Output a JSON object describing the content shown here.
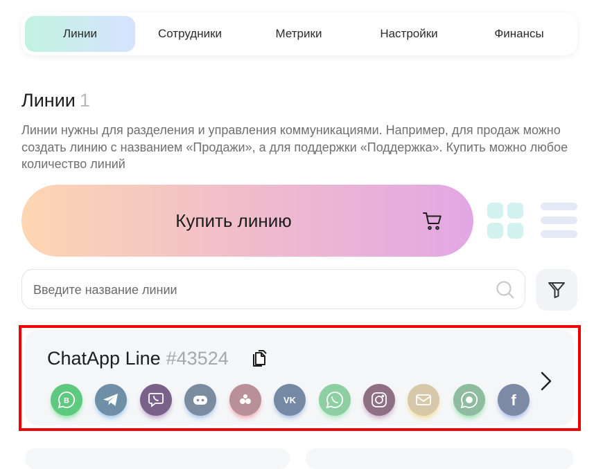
{
  "tabs": [
    {
      "label": "Линии",
      "active": true
    },
    {
      "label": "Сотрудники",
      "active": false
    },
    {
      "label": "Метрики",
      "active": false
    },
    {
      "label": "Настройки",
      "active": false
    },
    {
      "label": "Финансы",
      "active": false
    }
  ],
  "page": {
    "title": "Линии",
    "count": "1",
    "description": "Линии нужны для разделения и управления коммуникациями. Например, для продаж можно создать линию с названием «Продажи», а для поддержки «Поддержка». Купить можно любое количество линий"
  },
  "buy_button": {
    "label": "Купить линию",
    "icon": "cart-icon"
  },
  "view_toggle": {
    "options": [
      "grid-view-icon",
      "list-view-icon"
    ]
  },
  "search": {
    "placeholder": "Введите название линии",
    "value": "",
    "icon": "search-icon"
  },
  "filter": {
    "icon": "filter-icon"
  },
  "line_card": {
    "name": "ChatApp Line",
    "id": "#43524",
    "copy_icon": "copy-icon",
    "arrow_icon": "chevron-right-icon",
    "channels": [
      {
        "name": "whatsapp-business",
        "icon": "whatsapp-business-icon",
        "color": "#5ec97f",
        "glow": "#7be29a"
      },
      {
        "name": "telegram",
        "icon": "telegram-icon",
        "color": "#6f8fa7",
        "glow": "#8fc3ef"
      },
      {
        "name": "viber",
        "icon": "viber-icon",
        "color": "#7a6189",
        "glow": "#b59bc7"
      },
      {
        "name": "bot",
        "icon": "bot-icon",
        "color": "#7b8ca0",
        "glow": "#9cc0ee"
      },
      {
        "name": "odnoklassniki",
        "icon": "dots-icon",
        "color": "#b99099",
        "glow": "#f0a0a8"
      },
      {
        "name": "vk",
        "icon": "vk-icon",
        "color": "#7589a4",
        "glow": "#9fb7e0"
      },
      {
        "name": "whatsapp",
        "icon": "whatsapp-icon",
        "color": "#8dcfa3",
        "glow": "#a9ecbf"
      },
      {
        "name": "instagram",
        "icon": "instagram-icon",
        "color": "#8f6f84",
        "glow": "#c5a2bd"
      },
      {
        "name": "email",
        "icon": "mail-icon",
        "color": "#d6c8a8",
        "glow": "#f3dc86"
      },
      {
        "name": "whatsapp-cloud",
        "icon": "chat-bubble-icon",
        "color": "#8fbca0",
        "glow": "#8fe2a6"
      },
      {
        "name": "facebook",
        "icon": "facebook-icon",
        "color": "#7c8aa6",
        "glow": "#9eb4ea"
      }
    ]
  }
}
